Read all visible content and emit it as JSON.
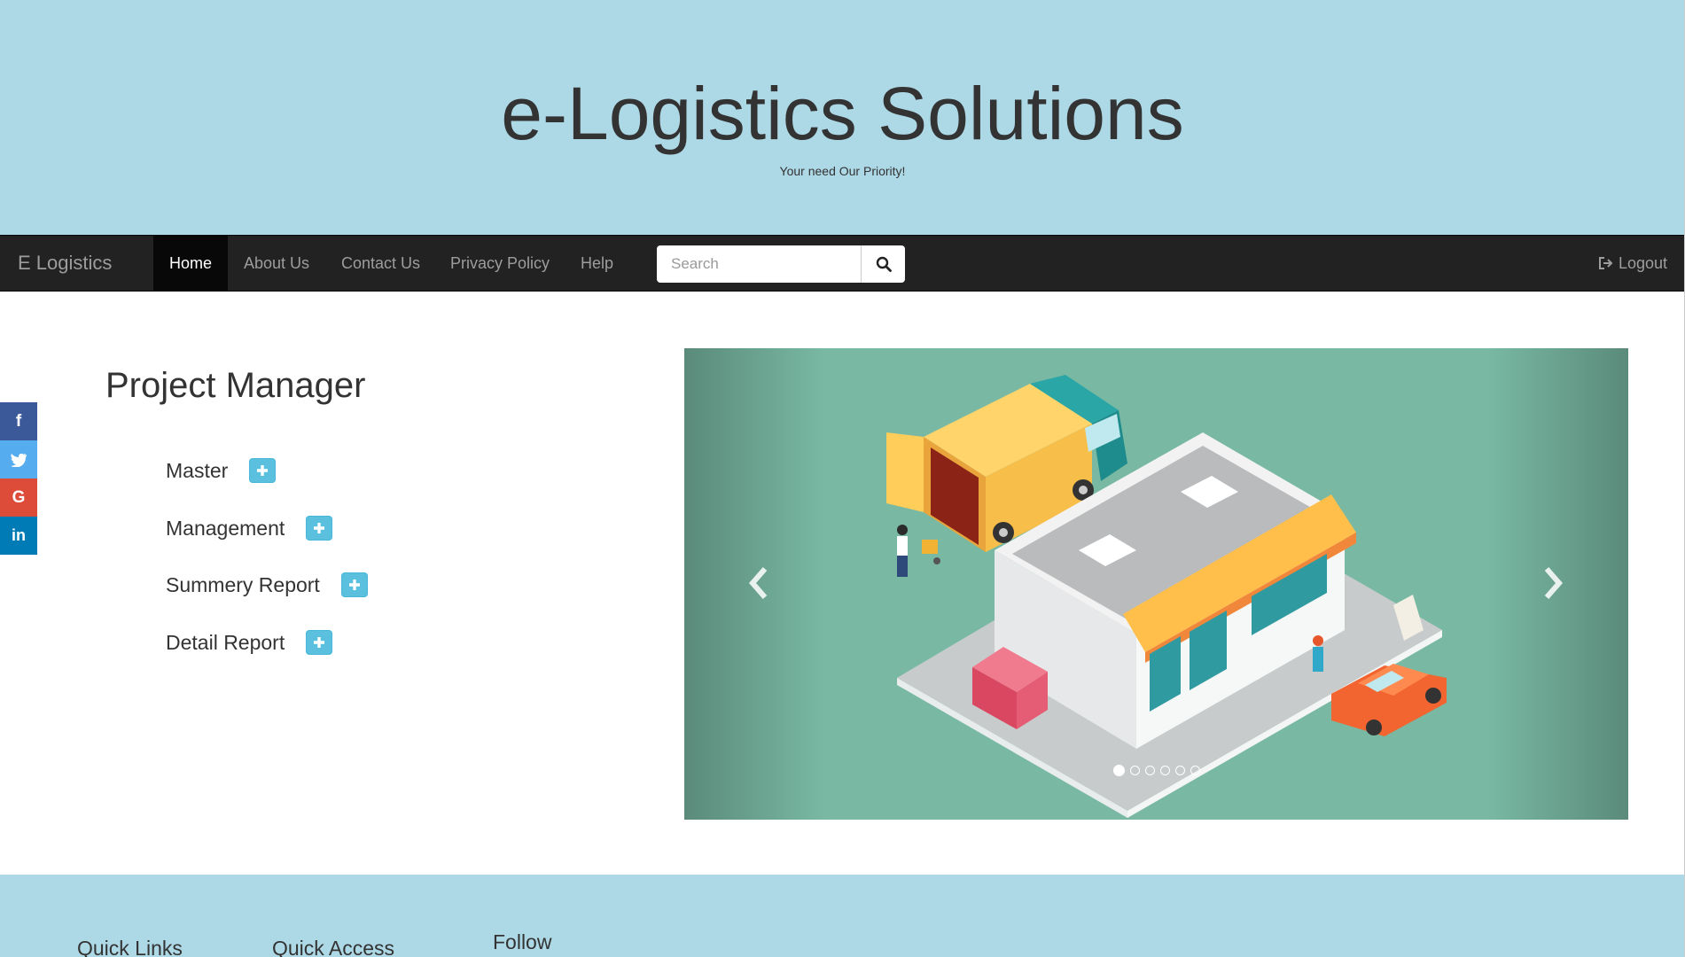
{
  "header": {
    "title": "e-Logistics Solutions",
    "tagline": "Your need Our Priority!"
  },
  "navbar": {
    "brand": "E Logistics",
    "items": [
      {
        "label": "Home",
        "active": true
      },
      {
        "label": "About Us"
      },
      {
        "label": "Contact Us"
      },
      {
        "label": "Privacy Policy"
      },
      {
        "label": "Help"
      }
    ],
    "search": {
      "placeholder": "Search",
      "value": "",
      "icon": "search-icon"
    },
    "logout": {
      "label": "Logout",
      "icon": "logout-icon"
    }
  },
  "social": [
    {
      "name": "facebook",
      "glyph": "f",
      "color": "#3b5998"
    },
    {
      "name": "twitter",
      "glyph": "t",
      "color": "#55acee"
    },
    {
      "name": "google",
      "glyph": "G",
      "color": "#dd4b39"
    },
    {
      "name": "linkedin",
      "glyph": "in",
      "color": "#007bb5"
    }
  ],
  "main": {
    "title": "Project Manager",
    "menu": [
      {
        "label": "Master"
      },
      {
        "label": "Management"
      },
      {
        "label": "Summery Report"
      },
      {
        "label": "Detail Report"
      }
    ]
  },
  "carousel": {
    "slide_count": 6,
    "active_slide": 1,
    "background": "#79b9a3"
  },
  "footer": {
    "headings": [
      "Quick Links",
      "Quick Access",
      "Follow"
    ]
  },
  "colors": {
    "header_bg": "#add8e6",
    "navbar_bg": "#222222",
    "info_button": "#5bc0de"
  }
}
